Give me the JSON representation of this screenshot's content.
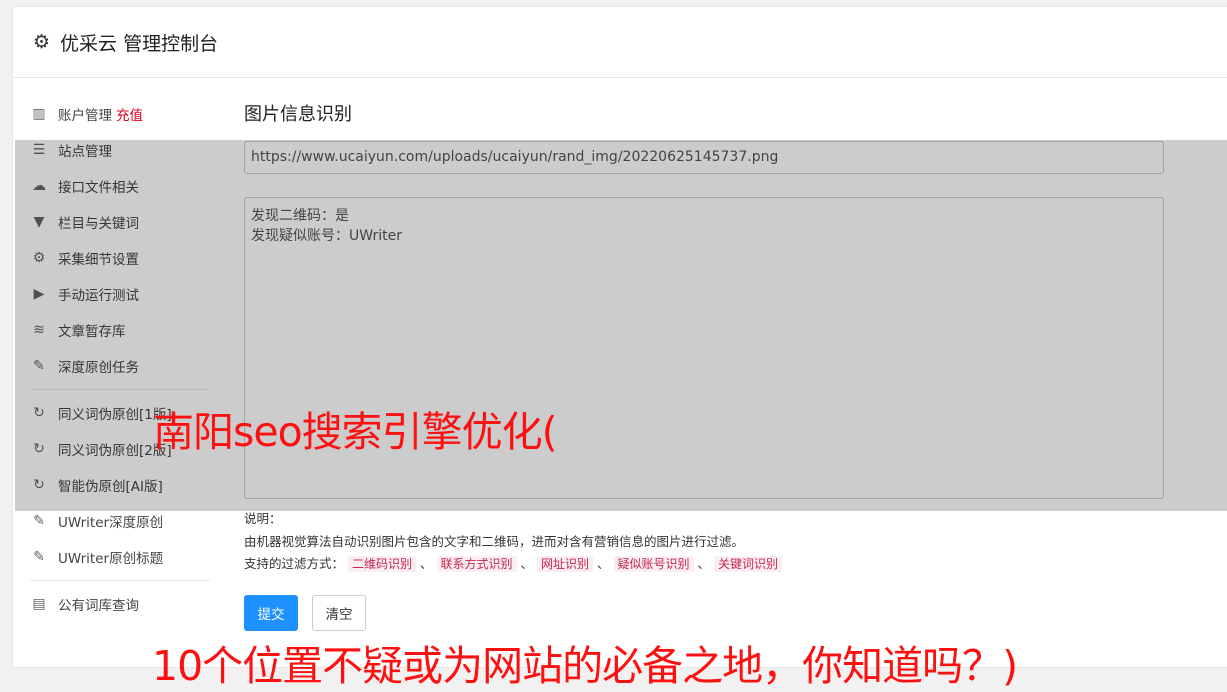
{
  "header": {
    "icon": "gear-icon",
    "title": "优采云 管理控制台"
  },
  "sidebar": {
    "items": [
      {
        "icon": "bar-chart-icon",
        "label": "账户管理",
        "badge": "充值"
      },
      {
        "icon": "server-icon",
        "label": "站点管理"
      },
      {
        "icon": "cloud-upload-icon",
        "label": "接口文件相关"
      },
      {
        "icon": "filter-icon",
        "label": "栏目与关键词"
      },
      {
        "icon": "cogs-icon",
        "label": "采集细节设置"
      },
      {
        "icon": "play-circle-icon",
        "label": "手动运行测试"
      },
      {
        "icon": "database-icon",
        "label": "文章暂存库"
      },
      {
        "icon": "edit-icon",
        "label": "深度原创任务"
      },
      {
        "icon": "refresh-icon",
        "label": "同义词伪原创[1版]"
      },
      {
        "icon": "refresh-icon",
        "label": "同义词伪原创[2版]"
      },
      {
        "icon": "refresh-icon",
        "label": "智能伪原创[AI版]"
      },
      {
        "icon": "edit-icon",
        "label": "UWriter深度原创"
      },
      {
        "icon": "edit-icon",
        "label": "UWriter原创标题"
      },
      {
        "icon": "book-icon",
        "label": "公有词库查询"
      }
    ]
  },
  "main": {
    "section_title": "图片信息识别",
    "url_value": "https://www.ucaiyun.com/uploads/ucaiyun/rand_img/20220625145737.png",
    "result_text": "发现二维码：是\n发现疑似账号：UWriter",
    "notes": {
      "heading": "说明：",
      "description": "由机器视觉算法自动识别图片包含的文字和二维码，进而对含有营销信息的图片进行过滤。",
      "filters_label": "支持的过滤方式：",
      "filters": [
        "二维码识别",
        "联系方式识别",
        "网址识别",
        "疑似账号识别",
        "关键词识别"
      ],
      "separator": "、"
    },
    "submit_label": "提交",
    "clear_label": "清空"
  },
  "watermark": {
    "line1": "南阳seo搜索引擎优化(",
    "line2": "10个位置不疑或为网站的必备之地，你知道吗？)"
  },
  "colors": {
    "primary": "#1e90ff",
    "danger": "#d8001f",
    "tag_text": "#c7254e",
    "watermark": "#ff1010"
  }
}
